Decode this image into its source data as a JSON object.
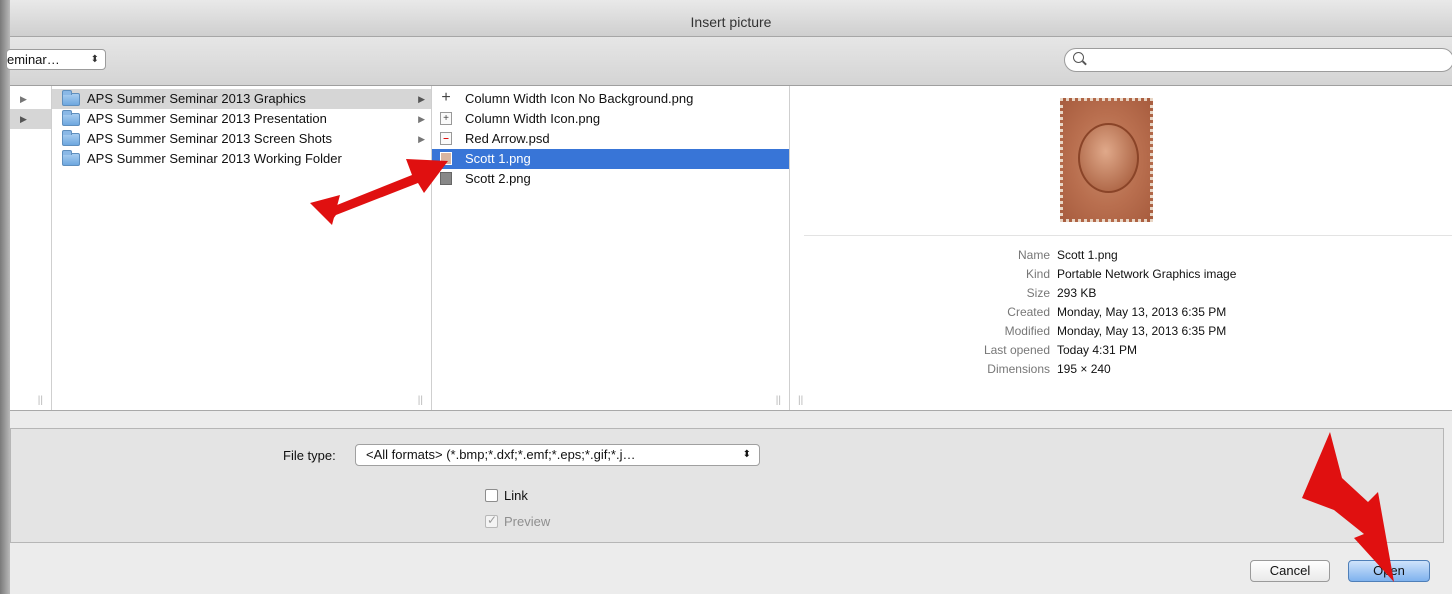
{
  "dialog": {
    "title": "Insert picture",
    "location_popup": "eminar…",
    "search_placeholder": ""
  },
  "browser": {
    "folders": [
      {
        "label": "APS Summer Seminar 2013 Graphics",
        "selected": true,
        "has_children": true
      },
      {
        "label": "APS Summer Seminar 2013 Presentation",
        "selected": false,
        "has_children": true
      },
      {
        "label": "APS Summer Seminar 2013 Screen Shots",
        "selected": false,
        "has_children": true
      },
      {
        "label": "APS Summer Seminar 2013 Working Folder",
        "selected": false,
        "has_children": false
      }
    ],
    "files": [
      {
        "label": "Column Width Icon No Background.png",
        "icon": "crosshair-icon",
        "selected": false
      },
      {
        "label": "Column Width Icon.png",
        "icon": "image-file-icon",
        "selected": false
      },
      {
        "label": "Red Arrow.psd",
        "icon": "psd-file-icon",
        "selected": false
      },
      {
        "label": "Scott 1.png",
        "icon": "image-file-icon",
        "selected": true
      },
      {
        "label": "Scott 2.png",
        "icon": "image-file-icon",
        "selected": false
      }
    ]
  },
  "preview": {
    "image_icon": "stamp-image",
    "info": [
      {
        "key": "Name",
        "value": "Scott 1.png"
      },
      {
        "key": "Kind",
        "value": "Portable Network Graphics image"
      },
      {
        "key": "Size",
        "value": "293 KB"
      },
      {
        "key": "Created",
        "value": "Monday, May 13, 2013 6:35 PM"
      },
      {
        "key": "Modified",
        "value": "Monday, May 13, 2013 6:35 PM"
      },
      {
        "key": "Last opened",
        "value": "Today 4:31 PM"
      },
      {
        "key": "Dimensions",
        "value": "195 × 240"
      }
    ]
  },
  "options": {
    "file_type_label": "File type:",
    "file_type_value": "<All formats> (*.bmp;*.dxf;*.emf;*.eps;*.gif;*.j…",
    "link_label": "Link",
    "link_checked": false,
    "preview_label": "Preview",
    "preview_checked": true
  },
  "buttons": {
    "cancel": "Cancel",
    "open": "Open"
  },
  "colors": {
    "selection_blue": "#3875d7",
    "annotation_red": "#e01010"
  }
}
